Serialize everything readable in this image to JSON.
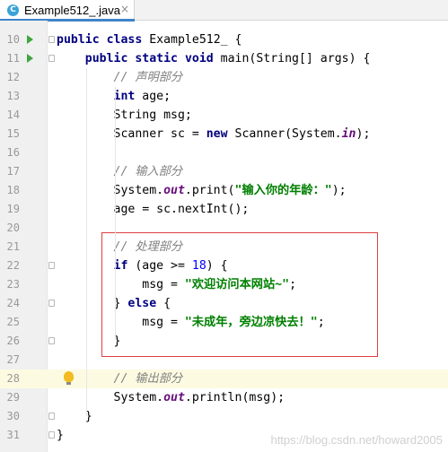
{
  "tab": {
    "icon": "java-class-icon",
    "icon_letter": "C",
    "title": "Example512_.java",
    "close": "×"
  },
  "lines": [
    {
      "n": "10",
      "parts": [
        {
          "t": "public",
          "c": "kw"
        },
        {
          "t": " "
        },
        {
          "t": "class",
          "c": "kw"
        },
        {
          "t": " Example512_ {"
        }
      ],
      "run": true,
      "fold": true
    },
    {
      "n": "11",
      "parts": [
        {
          "t": "    "
        },
        {
          "t": "public",
          "c": "kw"
        },
        {
          "t": " "
        },
        {
          "t": "static",
          "c": "kw"
        },
        {
          "t": " "
        },
        {
          "t": "void",
          "c": "kw"
        },
        {
          "t": " main(String[] args) {"
        }
      ],
      "run": true,
      "fold": true
    },
    {
      "n": "12",
      "parts": [
        {
          "t": "        "
        },
        {
          "t": "// 声明部分",
          "c": "cm"
        }
      ]
    },
    {
      "n": "13",
      "parts": [
        {
          "t": "        "
        },
        {
          "t": "int",
          "c": "kw"
        },
        {
          "t": " age;"
        }
      ]
    },
    {
      "n": "14",
      "parts": [
        {
          "t": "        String msg;"
        }
      ]
    },
    {
      "n": "15",
      "parts": [
        {
          "t": "        Scanner sc = "
        },
        {
          "t": "new",
          "c": "kw"
        },
        {
          "t": " Scanner(System."
        },
        {
          "t": "in",
          "c": "fd"
        },
        {
          "t": ");"
        }
      ]
    },
    {
      "n": "16",
      "parts": []
    },
    {
      "n": "17",
      "parts": [
        {
          "t": "        "
        },
        {
          "t": "// 输入部分",
          "c": "cm"
        }
      ]
    },
    {
      "n": "18",
      "parts": [
        {
          "t": "        System."
        },
        {
          "t": "out",
          "c": "fd"
        },
        {
          "t": ".print("
        },
        {
          "t": "\"输入你的年龄：\"",
          "c": "st"
        },
        {
          "t": ");"
        }
      ]
    },
    {
      "n": "19",
      "parts": [
        {
          "t": "        age = sc.nextInt();"
        }
      ]
    },
    {
      "n": "20",
      "parts": []
    },
    {
      "n": "21",
      "parts": [
        {
          "t": "        "
        },
        {
          "t": "// 处理部分",
          "c": "cm"
        }
      ]
    },
    {
      "n": "22",
      "parts": [
        {
          "t": "        "
        },
        {
          "t": "if",
          "c": "kw"
        },
        {
          "t": " (age >= "
        },
        {
          "t": "18",
          "c": "nm"
        },
        {
          "t": ") {"
        }
      ],
      "fold": true
    },
    {
      "n": "23",
      "parts": [
        {
          "t": "            msg = "
        },
        {
          "t": "\"欢迎访问本网站~\"",
          "c": "st"
        },
        {
          "t": ";"
        }
      ]
    },
    {
      "n": "24",
      "parts": [
        {
          "t": "        } "
        },
        {
          "t": "else",
          "c": "kw"
        },
        {
          "t": " {"
        }
      ],
      "fold": true
    },
    {
      "n": "25",
      "parts": [
        {
          "t": "            msg = "
        },
        {
          "t": "\"未成年，旁边凉快去！\"",
          "c": "st"
        },
        {
          "t": ";"
        }
      ]
    },
    {
      "n": "26",
      "parts": [
        {
          "t": "        }"
        }
      ],
      "fold": true
    },
    {
      "n": "27",
      "parts": []
    },
    {
      "n": "28",
      "parts": [
        {
          "t": "        "
        },
        {
          "t": "// 输出部分",
          "c": "cm"
        }
      ],
      "current": true,
      "bulb": true
    },
    {
      "n": "29",
      "parts": [
        {
          "t": "        System."
        },
        {
          "t": "out",
          "c": "fd"
        },
        {
          "t": ".println(msg);"
        }
      ]
    },
    {
      "n": "30",
      "parts": [
        {
          "t": "    }"
        }
      ],
      "fold": true
    },
    {
      "n": "31",
      "parts": [
        {
          "t": "}"
        }
      ],
      "fold": true
    }
  ],
  "watermark": "https://blog.csdn.net/howard2005",
  "colors": {
    "highlight_box": "#e04040",
    "current_line": "#fcfae1",
    "run_icon": "#3ea63e"
  }
}
